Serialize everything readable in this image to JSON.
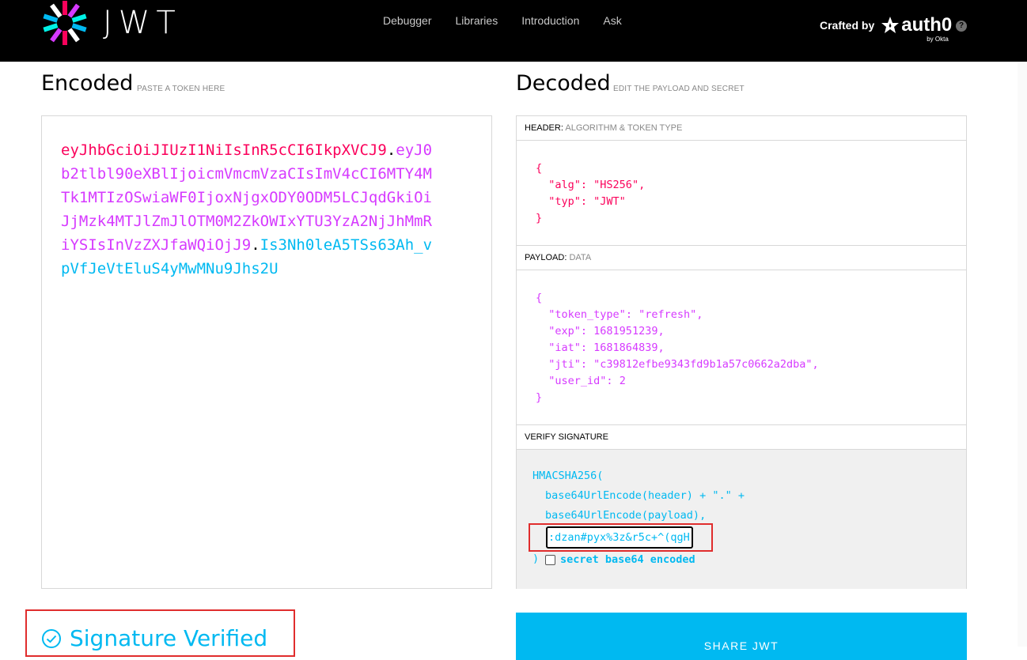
{
  "nav": {
    "logo_text": "JWT",
    "links": [
      "Debugger",
      "Libraries",
      "Introduction",
      "Ask"
    ],
    "crafted_by": "Crafted by",
    "brand": "auth0",
    "brand_sub": "by Okta",
    "help": "?"
  },
  "encoded": {
    "title": "Encoded",
    "subtitle": "PASTE A TOKEN HERE",
    "token_header": "eyJhbGciOiJIUzI1NiIsInR5cCI6IkpXVCJ9",
    "token_payload": "eyJ0b2tlbl90eXBlIjoicmVmcmVzaCIsImV4cCI6MTY4MTk1MTIzOSwiaWF0IjoxNjgxODY0ODM5LCJqdGkiOiJjMzk4MTJlZmJlOTM0M2ZkOWIxYTU3YzA2NjJhMmRiYSIsInVzZXJfaWQiOjJ9",
    "token_signature": "Is3Nh0leA5TSs63Ah_vpVfJeVtEluS4yMwMNu9Jhs2U",
    "dot": "."
  },
  "decoded": {
    "title": "Decoded",
    "subtitle": "EDIT THE PAYLOAD AND SECRET",
    "header_section": {
      "label": "HEADER:",
      "label_muted": "ALGORITHM & TOKEN TYPE",
      "alg_key": "\"alg\"",
      "alg_value": "\"HS256\"",
      "typ_key": "\"typ\"",
      "typ_value": "\"JWT\""
    },
    "payload_section": {
      "label": "PAYLOAD:",
      "label_muted": "DATA",
      "token_type_key": "\"token_type\"",
      "token_type_value": "\"refresh\"",
      "exp_key": "\"exp\"",
      "exp_value": "1681951239",
      "iat_key": "\"iat\"",
      "iat_value": "1681864839",
      "jti_key": "\"jti\"",
      "jti_value": "\"c39812efbe9343fd9b1a57c0662a2dba\"",
      "user_id_key": "\"user_id\"",
      "user_id_value": "2"
    },
    "verify_section": {
      "label": "VERIFY SIGNATURE",
      "fn_open": "HMACSHA256(",
      "line1": "base64UrlEncode(header) + \".\" +",
      "line2": "base64UrlEncode(payload),",
      "secret_value": ":dzan#pyx%3z&r5c+^(qgH",
      "close": ")",
      "checkbox_label": "secret base64 encoded"
    }
  },
  "status": {
    "verified_text": "Signature Verified"
  },
  "share_button": "SHARE JWT",
  "colors": {
    "header_red": "#fb015b",
    "payload_purple": "#d63aff",
    "signature_blue": "#00b9f1"
  }
}
